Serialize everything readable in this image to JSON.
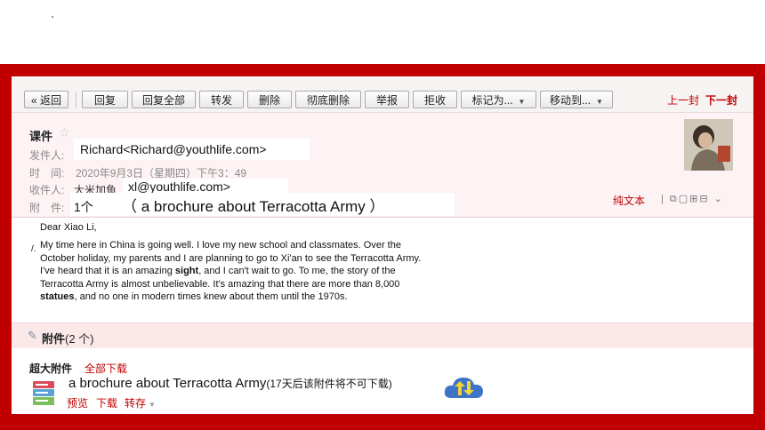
{
  "toolbar": {
    "back": "« 返回",
    "reply": "回复",
    "reply_all": "回复全部",
    "forward": "转发",
    "delete": "删除",
    "delete_permanently": "彻底删除",
    "report": "举报",
    "reject": "拒收",
    "mark_as": "标记为...",
    "move_to": "移动到...",
    "prev": "上一封",
    "next": "下一封"
  },
  "header": {
    "subject": "课件",
    "from_label": "发件人:",
    "from_value": "Richard<Richard@youthlife.com>",
    "time_label": "时　间:",
    "time_value": "2020年9月3日（星期四）下午3：49",
    "to_label": "收件人:",
    "to_name": "大米加鱼",
    "to_value": "xl@youthlife.com>",
    "attach_label": "附　件:",
    "attach_count": "1个",
    "attach_title": "（ a brochure about Terracotta Army ）",
    "text_view": "纯文本"
  },
  "body": {
    "greeting": "Dear Xiao Li,",
    "paragraph_parts": [
      "My time here in China is going well. I love my new school and classmates. Over the October holiday, my parents and I are planning to go to Xi'an to see the Terracotta Army. I've heard that it is an amazing ",
      "sight",
      ", and I can't wait to go. To me, the story of the Terracotta Army is almost unbelievable. It's amazing that there are more than 8,000 ",
      "statues",
      ", and no one in modern times knew about them until the 1970s."
    ]
  },
  "attachments": {
    "header_label": "附件",
    "header_count": "(2 个)",
    "big_label": "超大附件",
    "download_all": "全部下载",
    "file_name": "a brochure about Terracotta Army",
    "file_note": "(17天后该附件将不可下载)",
    "actions": [
      "预览",
      "下载",
      "转存"
    ]
  },
  "icons": {
    "star": "star-icon",
    "clip": "paperclip-icon",
    "file": "file-stack-icon",
    "cloud": "cloud-transfer-icon"
  },
  "colors": {
    "frame": "#c00000",
    "accent": "#c00000",
    "header_bg": "#fdf3f4"
  }
}
